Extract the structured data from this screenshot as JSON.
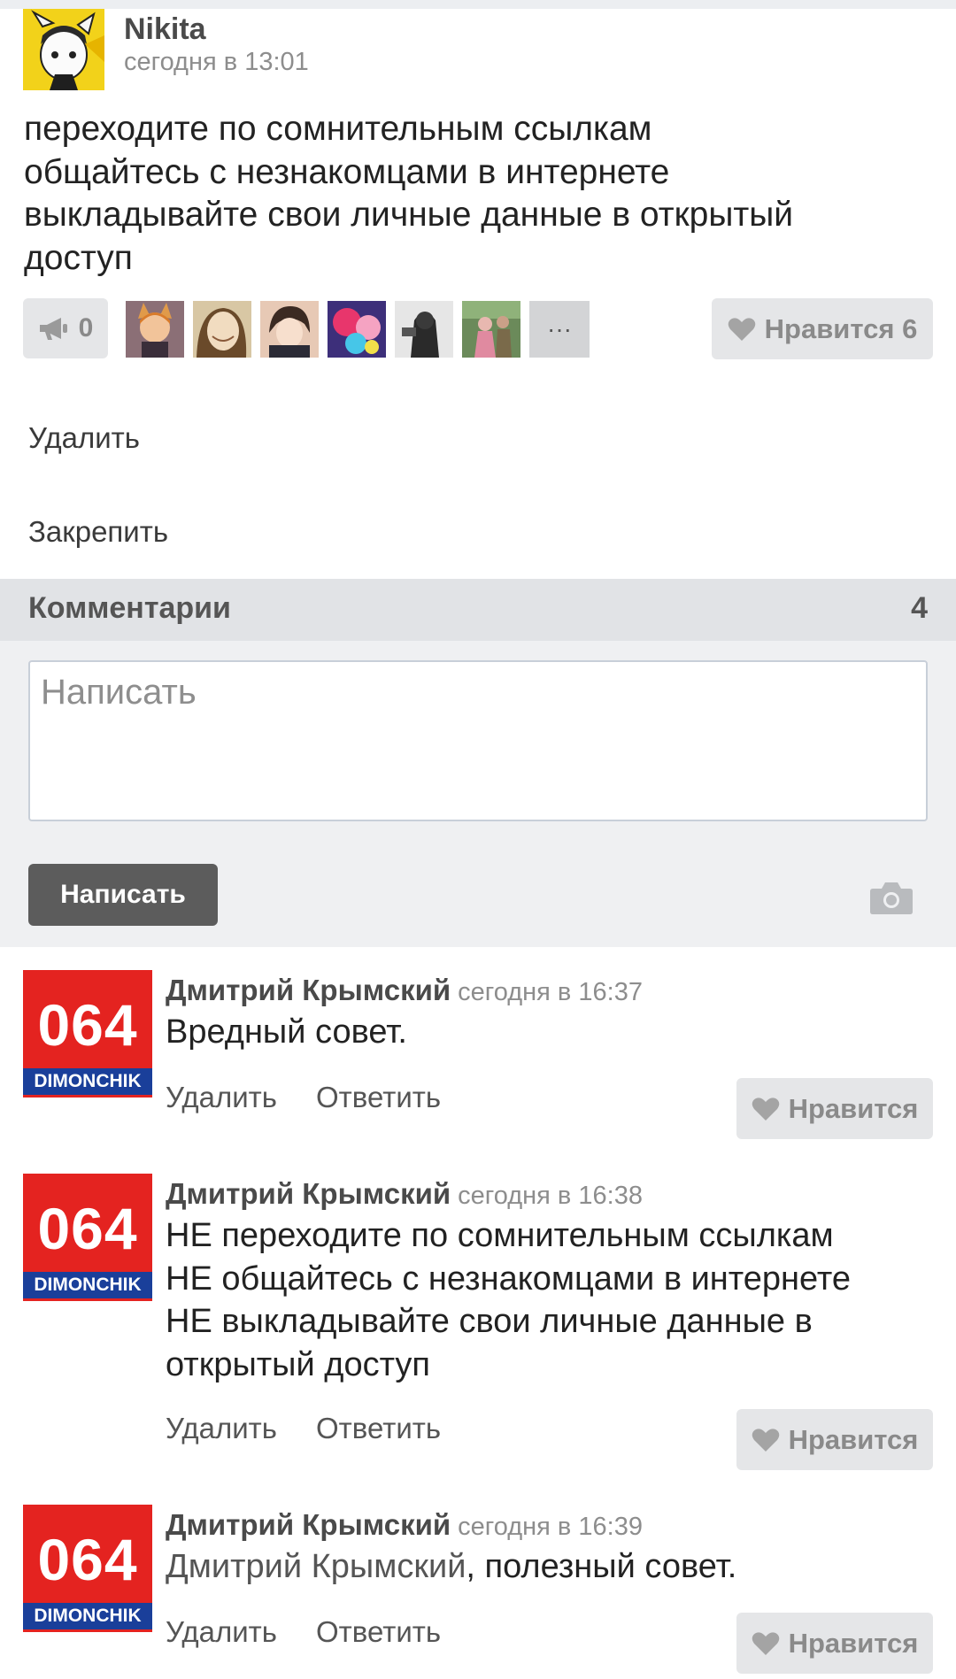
{
  "post": {
    "author": "Nikita",
    "time": "сегодня в 13:01",
    "text_lines": [
      "переходите по сомнительным ссылкам",
      "общайтесь с незнакомцами в интернете",
      "выкладывайте свои личные данные в открытый",
      "доступ"
    ],
    "reposts": "0",
    "more_likers": "···",
    "like_label": "Нравится 6",
    "menu": {
      "delete": "Удалить",
      "pin": "Закрепить"
    }
  },
  "comments_section": {
    "title": "Комментарии",
    "count": "4",
    "input_placeholder": "Написать",
    "submit_label": "Написать"
  },
  "avatar_badge": {
    "number": "064",
    "caption": "DIMONCHIK"
  },
  "comments": [
    {
      "author": "Дмитрий Крымский",
      "time": "сегодня в 16:37",
      "text_lines": [
        "Вредный совет."
      ],
      "delete": "Удалить",
      "reply": "Ответить",
      "like": "Нравится"
    },
    {
      "author": "Дмитрий Крымский",
      "time": "сегодня в 16:38",
      "text_lines": [
        "НЕ переходите по сомнительным ссылкам",
        "НЕ общайтесь с незнакомцами в интернете",
        "НЕ выкладывайте свои личные данные в",
        "открытый доступ"
      ],
      "delete": "Удалить",
      "reply": "Ответить",
      "like": "Нравится"
    },
    {
      "author": "Дмитрий Крымский",
      "time": "сегодня в 16:39",
      "mention": "Дмитрий Крымский",
      "text_rest": ", полезный совет.",
      "delete": "Удалить",
      "reply": "Ответить",
      "like": "Нравится"
    }
  ],
  "colors": {
    "badge_red": "#e42320",
    "badge_blue": "#1a3f9a",
    "button_dark": "#5c5c5c",
    "section_bar": "#e1e3e6"
  }
}
